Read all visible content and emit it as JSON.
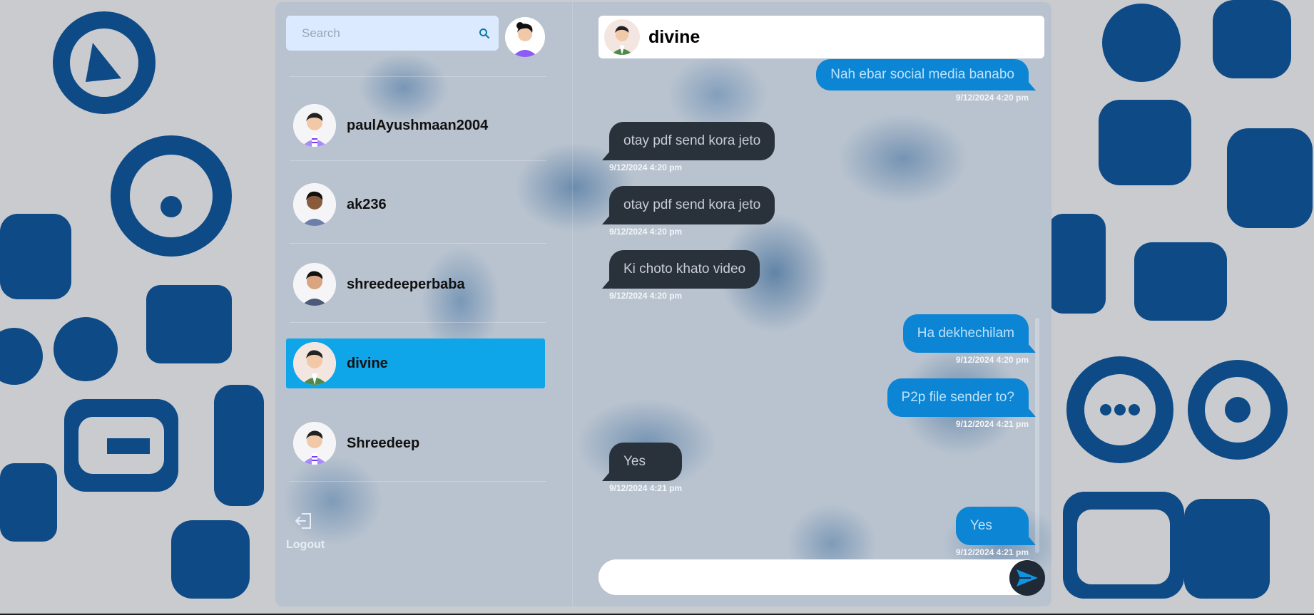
{
  "search": {
    "placeholder": "Search"
  },
  "conversations": [
    {
      "name": "paulAyushmaan2004",
      "active": false
    },
    {
      "name": "ak236",
      "active": false
    },
    {
      "name": "shreedeeperbaba",
      "active": false
    },
    {
      "name": "divine",
      "active": true
    },
    {
      "name": "Shreedeep",
      "active": false
    }
  ],
  "sidebar": {
    "logout_label": "Logout"
  },
  "chat": {
    "title": "divine",
    "messages": [
      {
        "direction": "out",
        "text": "Nah ebar social media banabo",
        "time": "9/12/2024 4:20 pm"
      },
      {
        "direction": "in",
        "text": "otay pdf send kora jeto",
        "time": "9/12/2024 4:20 pm"
      },
      {
        "direction": "in",
        "text": "otay pdf send kora jeto",
        "time": "9/12/2024 4:20 pm"
      },
      {
        "direction": "in",
        "text": "Ki choto khato video",
        "time": "9/12/2024 4:20 pm"
      },
      {
        "direction": "out",
        "text": "Ha dekhechilam",
        "time": "9/12/2024 4:20 pm"
      },
      {
        "direction": "out",
        "text": "P2p file sender to?",
        "time": "9/12/2024 4:21 pm"
      },
      {
        "direction": "in",
        "text": "Yes",
        "time": "9/12/2024 4:21 pm"
      },
      {
        "direction": "out",
        "text": "Yes",
        "time": "9/12/2024 4:21 pm"
      }
    ],
    "composer_value": ""
  },
  "colors": {
    "accent": "#0ea5e9",
    "outgoing_bubble": "#0b85d4",
    "incoming_bubble": "#29313b",
    "doodle": "#0d4a86"
  },
  "icons": {
    "search": "search-icon",
    "send": "send-icon",
    "logout": "logout-icon"
  }
}
